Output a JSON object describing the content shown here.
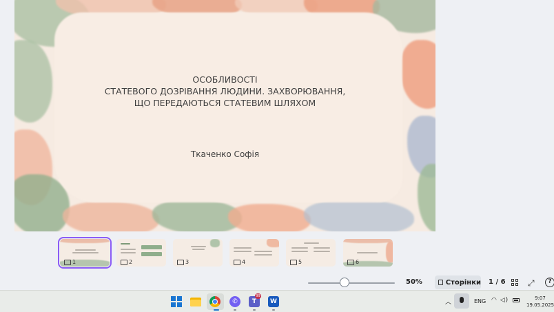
{
  "slide": {
    "title_lines": [
      "ОСОБЛИВОСТІ",
      "СТАТЕВОГО ДОЗРІВАННЯ ЛЮДИНИ. ЗАХВОРЮВАННЯ,",
      "ЩО ПЕРЕДАЮТЬСЯ СТАТЕВИМ ШЛЯХОМ"
    ],
    "author": "Ткаченко Софія"
  },
  "thumbnails": [
    {
      "num": "1",
      "active": true
    },
    {
      "num": "2",
      "active": false
    },
    {
      "num": "3",
      "active": false
    },
    {
      "num": "4",
      "active": false
    },
    {
      "num": "5",
      "active": false
    },
    {
      "num": "6",
      "active": false
    }
  ],
  "bottom_bar": {
    "zoom_percent": 50,
    "zoom_label": "50%",
    "pages_label": "Сторінки",
    "page_counter": "1 / 6",
    "help_label": "?"
  },
  "taskbar": {
    "apps": [
      "windows-start",
      "file-explorer",
      "chrome",
      "viber",
      "teams",
      "word"
    ],
    "teams_badge": "99",
    "language": "ENG",
    "time": "9:07",
    "date": "19.05.2025"
  },
  "colors": {
    "accent": "#8b5cf6",
    "slide_bg": "#f6ebe2",
    "paint_peach": "#eea98d",
    "paint_sage": "#9cb597",
    "paint_blue": "#a9b7c9"
  }
}
